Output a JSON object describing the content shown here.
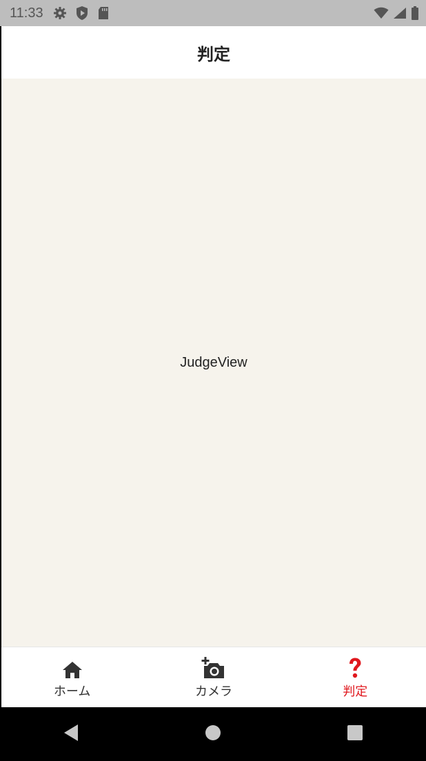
{
  "status_bar": {
    "time": "11:33",
    "left_icons": [
      "gear-icon",
      "shield-play-icon",
      "sd-card-icon"
    ],
    "right_icons": [
      "wifi-icon",
      "signal-icon",
      "battery-icon"
    ]
  },
  "header": {
    "title": "判定"
  },
  "main": {
    "text": "JudgeView"
  },
  "bottom_nav": {
    "items": [
      {
        "label": "ホーム",
        "icon": "home-icon",
        "active": false
      },
      {
        "label": "カメラ",
        "icon": "add-camera-icon",
        "active": false
      },
      {
        "label": "判定",
        "icon": "question-icon",
        "active": true
      }
    ],
    "active_color": "#e0181e"
  },
  "system_nav": {
    "buttons": [
      "back-icon",
      "home-circle-icon",
      "recents-icon"
    ]
  },
  "colors": {
    "content_bg": "#f6f3ec",
    "status_bg": "#bdbdbd"
  }
}
